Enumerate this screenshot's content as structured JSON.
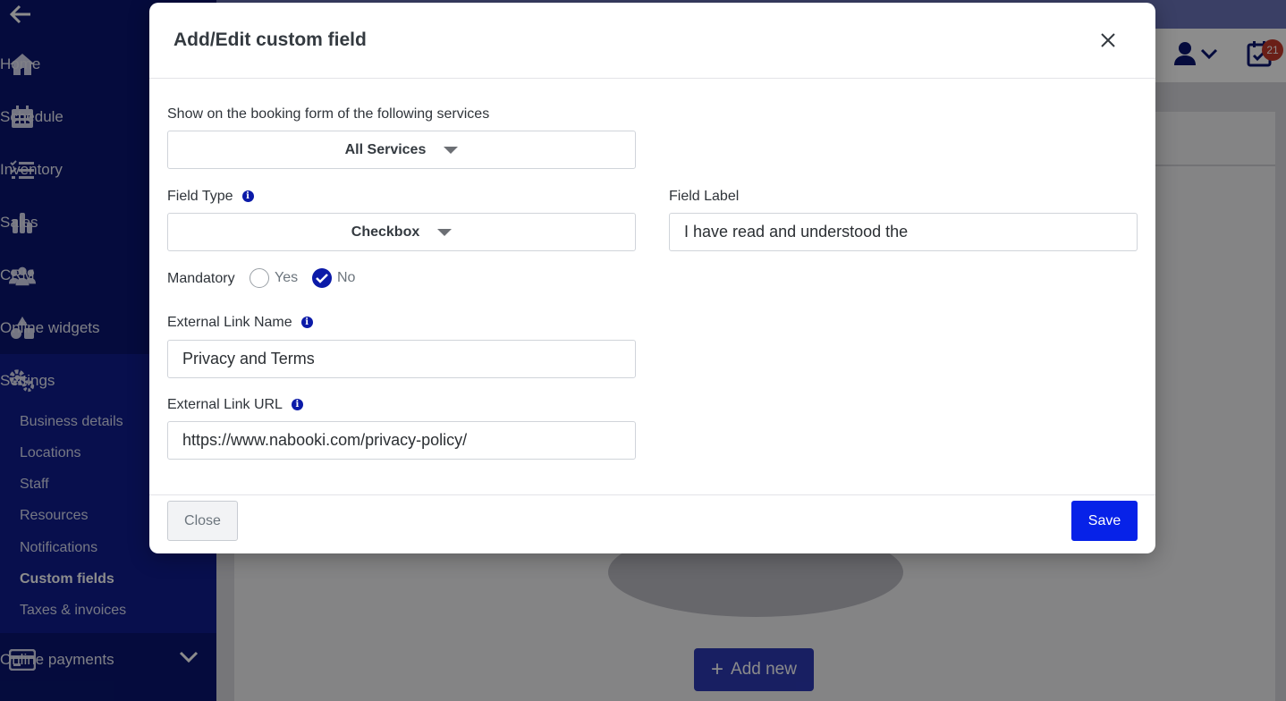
{
  "sidebar": {
    "items": [
      {
        "label": "Home",
        "icon": "home-icon"
      },
      {
        "label": "Schedule",
        "icon": "calendar-icon"
      },
      {
        "label": "Inventory",
        "icon": "checklist-icon"
      },
      {
        "label": "Sales",
        "icon": "bar-chart-icon"
      },
      {
        "label": "CRM",
        "icon": "users-icon"
      },
      {
        "label": "Online widgets",
        "icon": "shapes-icon"
      },
      {
        "label": "Settings",
        "icon": "gears-icon"
      }
    ],
    "settings_sub": [
      {
        "label": "Business details"
      },
      {
        "label": "Locations"
      },
      {
        "label": "Staff"
      },
      {
        "label": "Resources"
      },
      {
        "label": "Notifications"
      },
      {
        "label": "Custom fields",
        "active": true
      },
      {
        "label": "Taxes & invoices"
      }
    ],
    "online_payments": "Online payments"
  },
  "header": {
    "notification_count": "21"
  },
  "background": {
    "add_new_label": "Add new"
  },
  "modal": {
    "title": "Add/Edit custom field",
    "services_label": "Show on the booking form of the following services",
    "services_value": "All Services",
    "field_type_label": "Field Type",
    "field_type_value": "Checkbox",
    "field_label_label": "Field Label",
    "field_label_value": "I have read and understood the",
    "mandatory_label": "Mandatory",
    "mandatory_yes": "Yes",
    "mandatory_no": "No",
    "mandatory_selected": "No",
    "link_name_label": "External Link Name",
    "link_name_value": "Privacy and Terms",
    "link_url_label": "External Link URL",
    "link_url_value": "https://www.nabooki.com/privacy-policy/",
    "close_label": "Close",
    "save_label": "Save"
  },
  "colors": {
    "sidebar_bg": "#0a1570",
    "primary": "#0722e8",
    "badge": "#c1392b"
  }
}
